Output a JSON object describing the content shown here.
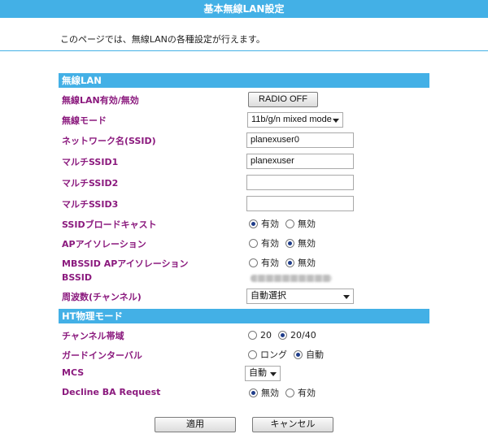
{
  "header": {
    "title": "基本無線LAN設定"
  },
  "intro": {
    "text": "このページでは、無線LANの各種設定が行えます。"
  },
  "sections": {
    "wireless": {
      "title": "無線LAN"
    },
    "ht": {
      "title": "HT物理モード"
    }
  },
  "wireless": {
    "enable": {
      "label": "無線LAN有効/無効",
      "button": "RADIO OFF"
    },
    "mode": {
      "label": "無線モード",
      "value": "11b/g/n mixed mode"
    },
    "ssid": {
      "label": "ネットワーク名(SSID)",
      "value": "planexuser0"
    },
    "multi1": {
      "label": "マルチSSID1",
      "value": "planexuser"
    },
    "multi2": {
      "label": "マルチSSID2",
      "value": ""
    },
    "multi3": {
      "label": "マルチSSID3",
      "value": ""
    },
    "broadcast": {
      "label": "SSIDブロードキャスト",
      "opt_on": "有効",
      "opt_off": "無効",
      "selected": "有効"
    },
    "ap_isolation": {
      "label": "APアイソレーション",
      "opt_on": "有効",
      "opt_off": "無効",
      "selected": "無効"
    },
    "mbssid_isolation": {
      "label": "MBSSID APアイソレーション",
      "opt_on": "有効",
      "opt_off": "無効",
      "selected": "無効"
    },
    "bssid": {
      "label": "BSSID"
    },
    "frequency": {
      "label": "周波数(チャンネル)",
      "value": "自動選択"
    }
  },
  "ht": {
    "bandwidth": {
      "label": "チャンネル帯域",
      "opt_a": "20",
      "opt_b": "20/40",
      "selected": "20/40"
    },
    "guard": {
      "label": "ガードインターバル",
      "opt_a": "ロング",
      "opt_b": "自動",
      "selected": "自動"
    },
    "mcs": {
      "label": "MCS",
      "value": "自動"
    },
    "decline_ba": {
      "label": "Decline BA Request",
      "opt_a": "無効",
      "opt_b": "有効",
      "selected": "無効"
    }
  },
  "footer": {
    "apply": "適用",
    "cancel": "キャンセル"
  }
}
